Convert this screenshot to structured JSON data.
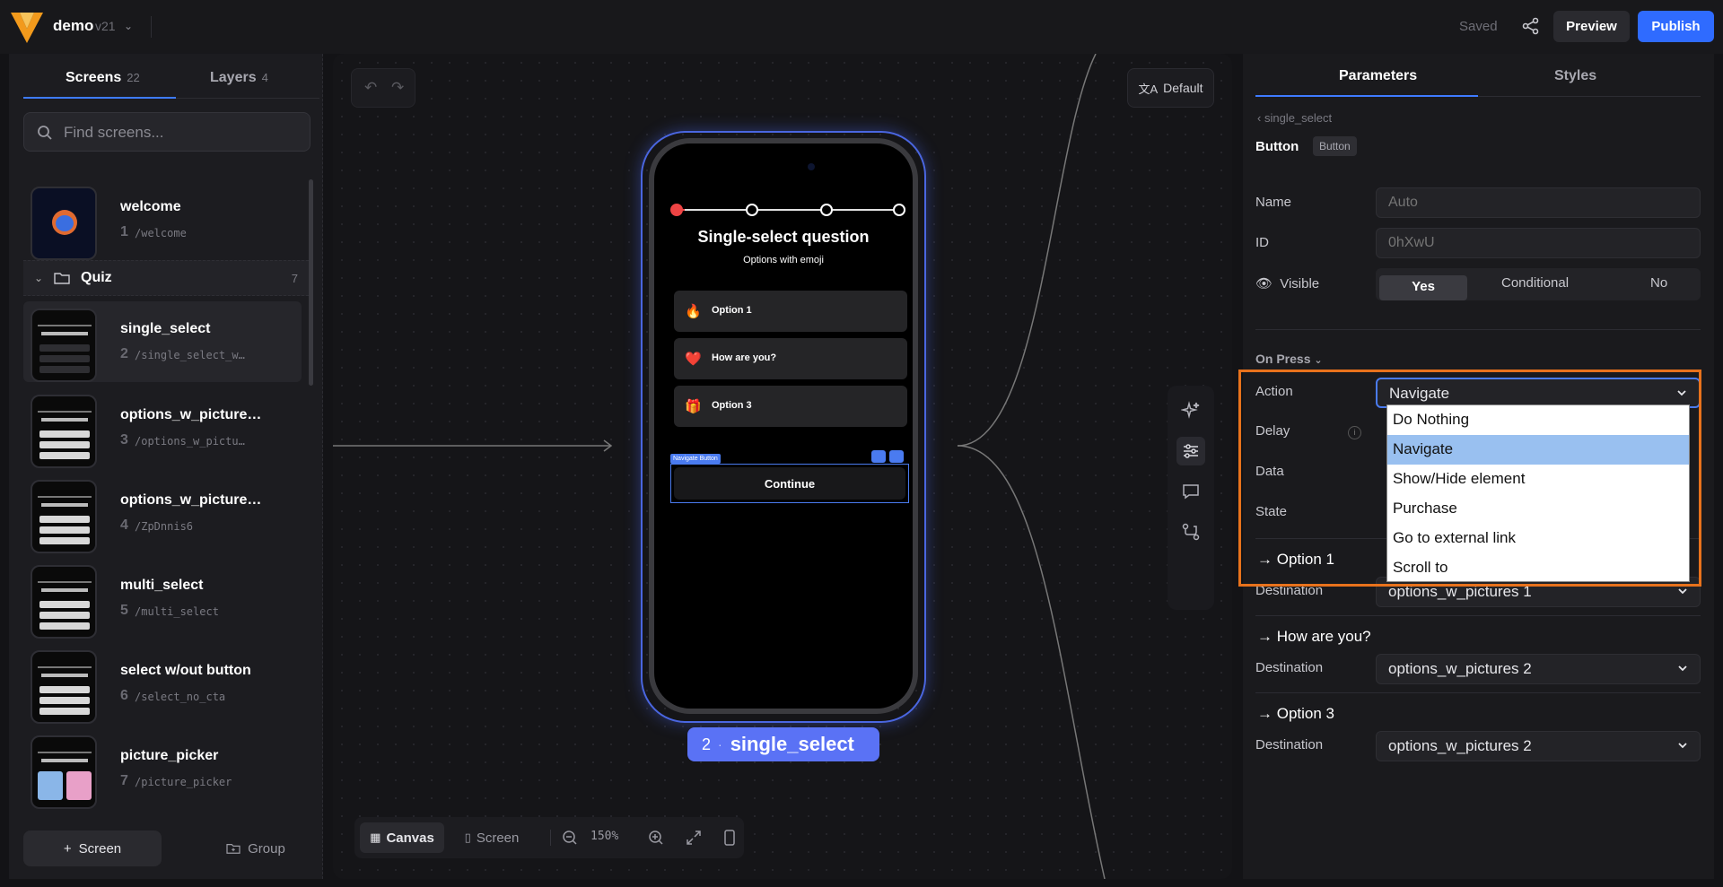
{
  "app": {
    "project_name": "demo",
    "version": "v21",
    "status": "Saved",
    "preview_label": "Preview",
    "publish_label": "Publish"
  },
  "left_panel": {
    "tabs": [
      {
        "label": "Screens",
        "count": "22"
      },
      {
        "label": "Layers",
        "count": "4"
      }
    ],
    "search_placeholder": "Find screens...",
    "group": {
      "name": "Quiz",
      "count": "7"
    },
    "items": [
      {
        "name": "welcome",
        "num": "1",
        "path": "/welcome"
      },
      {
        "name": "single_select",
        "num": "2",
        "path": "/single_select_w…"
      },
      {
        "name": "options_w_picture…",
        "num": "3",
        "path": "/options_w_pictu…"
      },
      {
        "name": "options_w_picture…",
        "num": "4",
        "path": "/ZpDnnis6"
      },
      {
        "name": "multi_select",
        "num": "5",
        "path": "/multi_select"
      },
      {
        "name": "select w/out button",
        "num": "6",
        "path": "/select_no_cta"
      },
      {
        "name": "picture_picker",
        "num": "7",
        "path": "/picture_picker"
      }
    ],
    "add_screen_label": "Screen",
    "add_group_label": "Group"
  },
  "canvas": {
    "default_label": "Default",
    "bottom_bar": {
      "canvas_label": "Canvas",
      "screen_label": "Screen",
      "zoom": "150%"
    },
    "screen_label": {
      "num": "2",
      "name": "single_select"
    },
    "phone": {
      "title": "Single-select question",
      "subtitle": "Options with emoji",
      "options": [
        {
          "emoji": "🔥",
          "label": "Option 1"
        },
        {
          "emoji": "❤️",
          "label": "How are you?"
        },
        {
          "emoji": "🎁",
          "label": "Option 3"
        }
      ],
      "nav_tag": "Navigate Button",
      "cta_label": "Continue"
    }
  },
  "right_panel": {
    "tabs": [
      "Parameters",
      "Styles"
    ],
    "breadcrumb": "single_select",
    "element_name": "Button",
    "element_type": "Button",
    "fields": {
      "name_label": "Name",
      "name_placeholder": "Auto",
      "id_label": "ID",
      "id_placeholder": "0hXwU",
      "visible_label": "Visible",
      "visible_options": [
        "Yes",
        "Conditional",
        "No"
      ],
      "visible_selected": "Yes"
    },
    "on_press_label": "On Press",
    "action_label": "Action",
    "action_value": "Navigate",
    "delay_label": "Delay",
    "data_label": "Data",
    "state_label": "State",
    "destinations": [
      {
        "option": "→ Option 1",
        "label": "Destination",
        "value": "options_w_pictures 1"
      },
      {
        "option": "→ How are you?",
        "label": "Destination",
        "value": "options_w_pictures 2"
      },
      {
        "option": "→ Option 3",
        "label": "Destination",
        "value": "options_w_pictures 2"
      }
    ]
  },
  "action_dropdown": {
    "options": [
      "Do Nothing",
      "Navigate",
      "Show/Hide element",
      "Purchase",
      "Go to external link",
      "Scroll to"
    ],
    "highlighted": "Navigate"
  },
  "colors": {
    "accent": "#2f6bff",
    "highlight_box": "#e8721c",
    "screen_label": "#5a72f5"
  }
}
